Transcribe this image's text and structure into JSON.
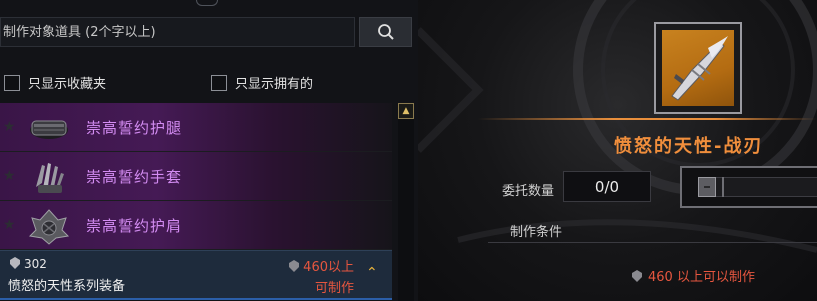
{
  "search": {
    "placeholder": "制作对象道具 (2个字以上)"
  },
  "filters": {
    "favorites_label": "只显示收藏夹",
    "owned_label": "只显示拥有的"
  },
  "list": {
    "items": [
      {
        "label": "崇高誓约护腿",
        "icon": "leg-armor-icon"
      },
      {
        "label": "崇高誓约手套",
        "icon": "glove-icon"
      },
      {
        "label": "崇高誓约护肩",
        "icon": "shoulder-armor-icon"
      }
    ],
    "group": {
      "level": "302",
      "name": "愤怒的天性系列装备",
      "requirement": "460以上",
      "craftable": "可制作"
    }
  },
  "detail": {
    "item_name": "愤怒的天性-战刃",
    "item_icon": "war-blade-icon",
    "quantity_label": "委托数量",
    "quantity_value": "0/0",
    "condition_label": "制作条件",
    "condition_text": "460 以上可以制作"
  },
  "colors": {
    "accent_purple": "#d38cf2",
    "accent_orange": "#f08e3c",
    "warning_red": "#e6563f",
    "item_bg_orange": "#c8821f"
  }
}
